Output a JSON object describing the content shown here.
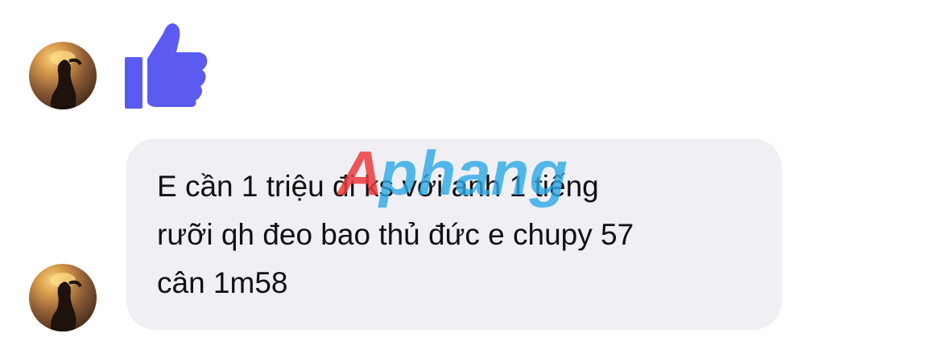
{
  "conversation": {
    "message_1": {
      "type": "like-reaction",
      "icon": "thumbs-up-icon",
      "color": "#5b5bf2"
    },
    "message_2": {
      "text": "E cần 1 triệu đi ks với anh 1 tiếng\nrưỡi qh đeo bao thủ đức e chupy 57\ncân 1m58"
    }
  },
  "watermark": {
    "text": "Aphang",
    "colors": [
      "#ee3b3b",
      "#2da9e6"
    ]
  }
}
